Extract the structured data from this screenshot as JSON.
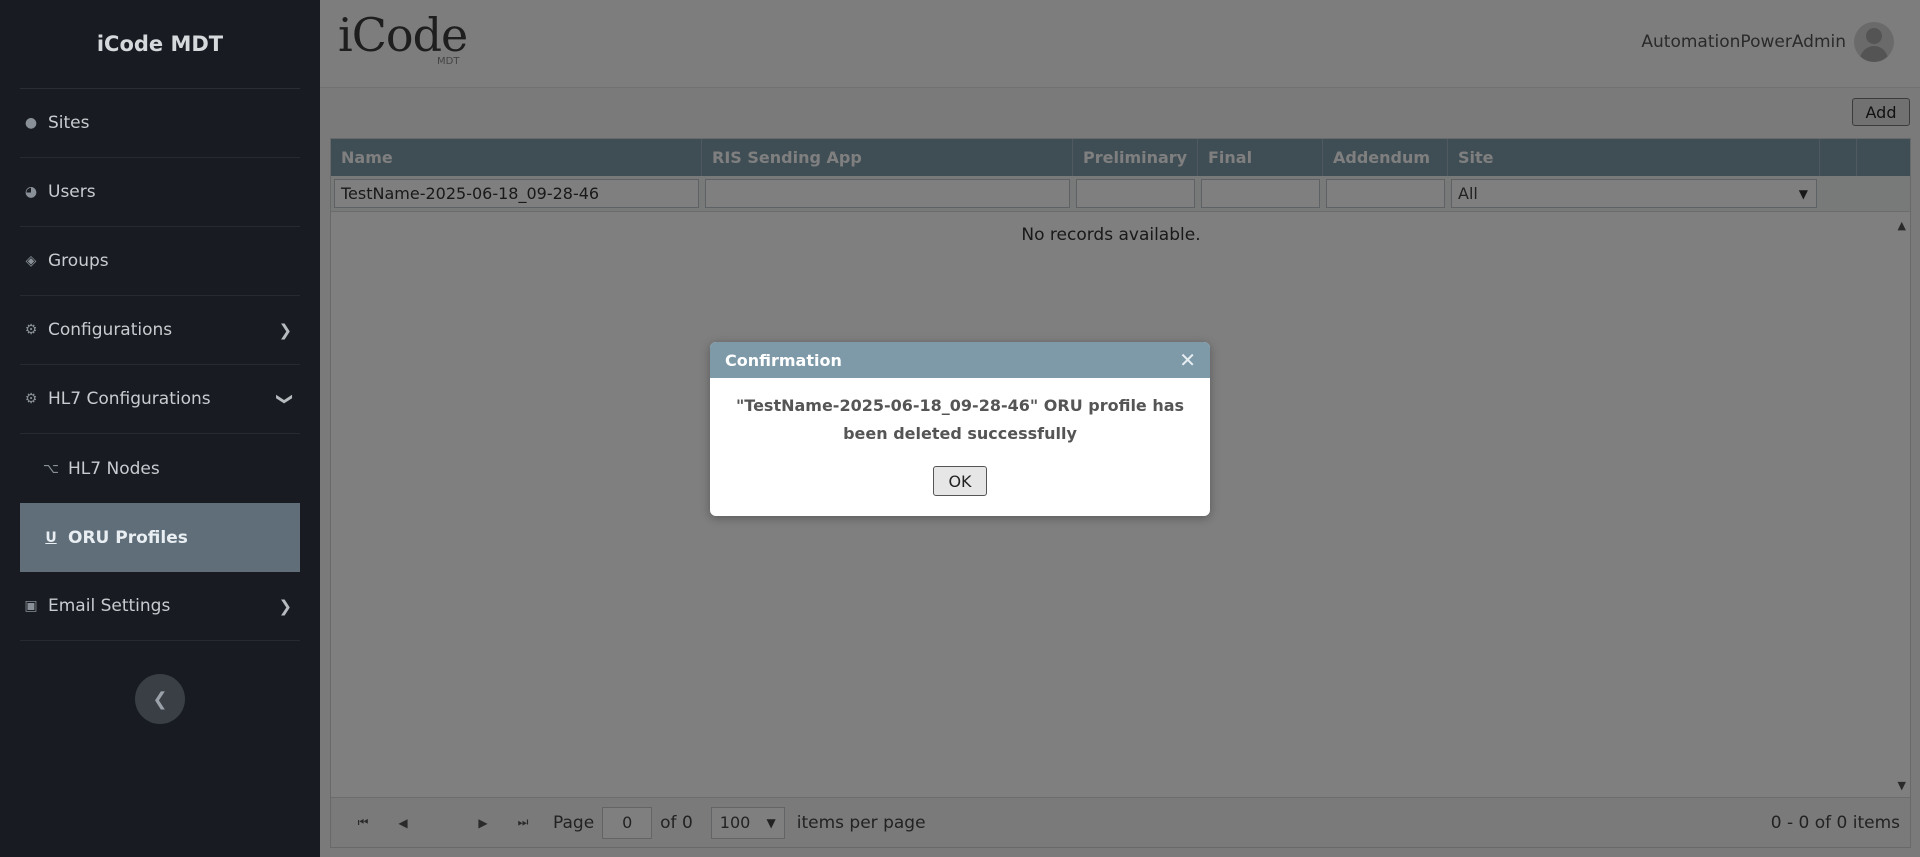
{
  "app": {
    "brand": "iCode MDT",
    "logo_text": "iCode",
    "logo_sub": "MDT"
  },
  "user": {
    "name": "AutomationPowerAdmin"
  },
  "sidebar": {
    "items": [
      {
        "label": "Sites",
        "icon": "map-pin-icon"
      },
      {
        "label": "Users",
        "icon": "user-icon"
      },
      {
        "label": "Groups",
        "icon": "layers-icon"
      },
      {
        "label": "Configurations",
        "icon": "gear-icon"
      },
      {
        "label": "HL7 Configurations",
        "icon": "gears-icon"
      },
      {
        "label": "HL7 Nodes",
        "icon": "nodes-icon"
      },
      {
        "label": "ORU Profiles",
        "icon": "underline-icon"
      },
      {
        "label": "Email Settings",
        "icon": "mail-truck-icon"
      }
    ]
  },
  "toolbar": {
    "add_label": "Add"
  },
  "grid": {
    "columns": [
      "Name",
      "RIS Sending App",
      "Preliminary",
      "Final",
      "Addendum",
      "Site"
    ],
    "filters": {
      "name": "TestName-2025-06-18_09-28-46",
      "ris": "",
      "preliminary": "",
      "final": "",
      "addendum": "",
      "site": "All"
    },
    "empty_text": "No records available."
  },
  "pager": {
    "page_label": "Page",
    "page_value": "0",
    "of_label": "of 0",
    "page_size": "100",
    "per_page_label": "items per page",
    "info": "0 - 0 of 0 items"
  },
  "modal": {
    "title": "Confirmation",
    "message": "\"TestName-2025-06-18_09-28-46\" ORU profile has been deleted successfully",
    "ok_label": "OK"
  }
}
